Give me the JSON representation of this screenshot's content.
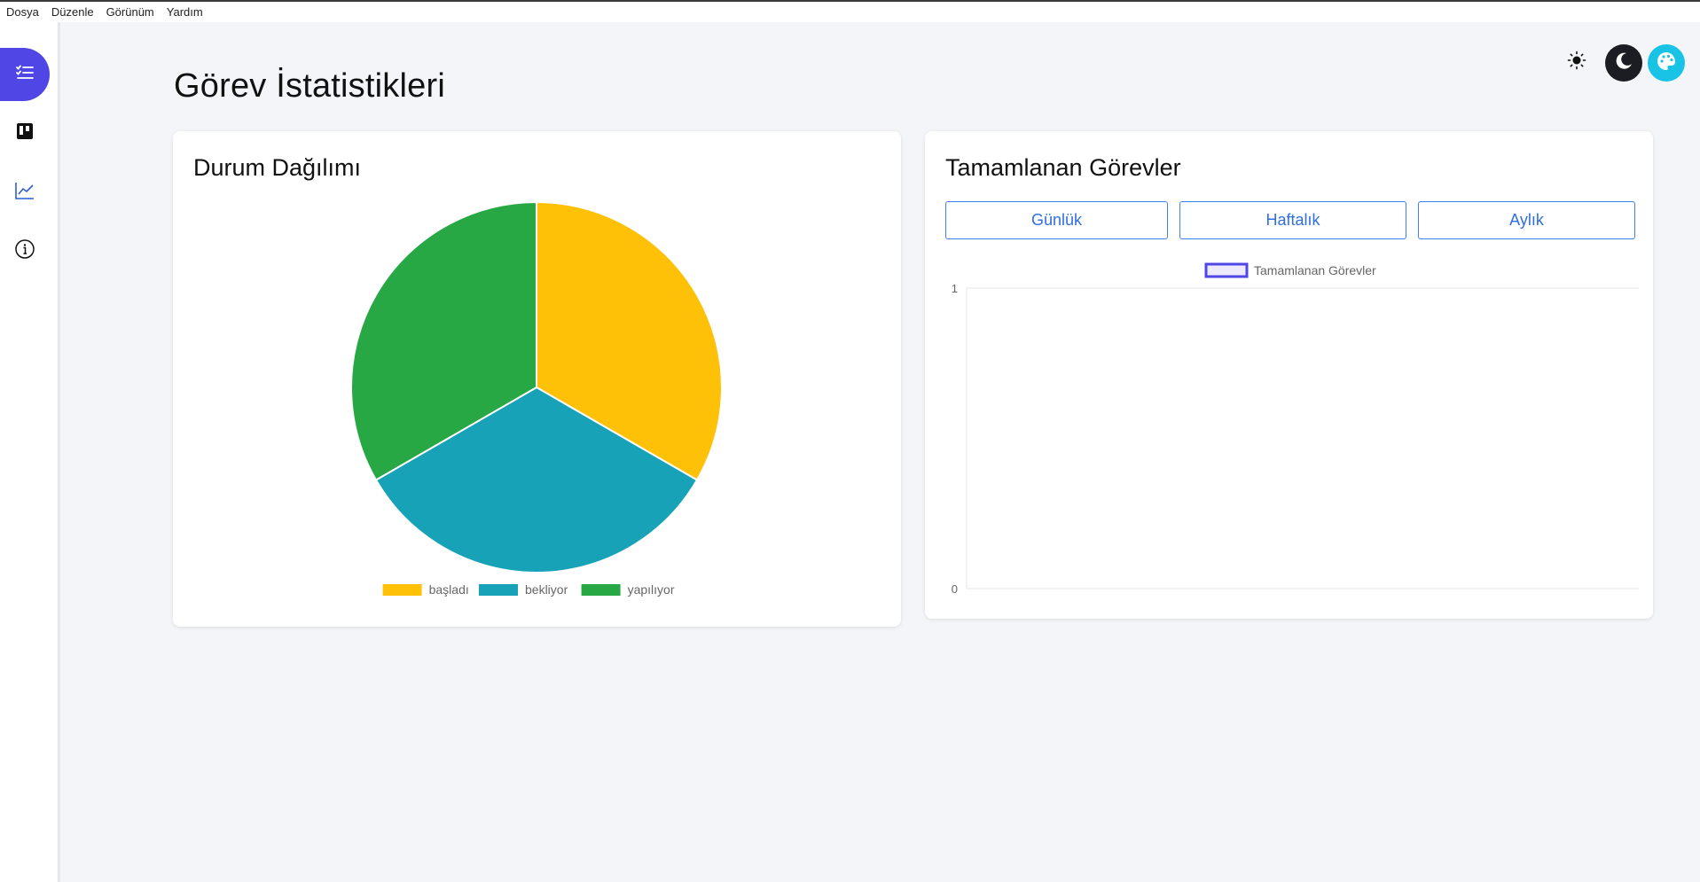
{
  "menu": {
    "items": [
      "Dosya",
      "Düzenle",
      "Görünüm",
      "Yardım"
    ]
  },
  "sidebar": {
    "items": [
      {
        "icon": "task-list-icon",
        "active": true
      },
      {
        "icon": "kanban-board-icon",
        "active": false
      },
      {
        "icon": "line-chart-icon",
        "active": false
      },
      {
        "icon": "info-icon",
        "active": false
      }
    ],
    "accent": "#4f46e5"
  },
  "page": {
    "title": "Görev İstatistikleri"
  },
  "theme": {
    "light_icon": "sun-icon",
    "dark_icon": "moon-icon",
    "custom_icon": "palette-icon"
  },
  "status_card": {
    "title": "Durum Dağılımı"
  },
  "completed_card": {
    "title": "Tamamlanan Görevler",
    "buttons": {
      "daily": "Günlük",
      "weekly": "Haftalık",
      "monthly": "Aylık"
    }
  },
  "chart_data": [
    {
      "type": "pie",
      "title": "Durum Dağılımı",
      "categories": [
        "başladı",
        "bekliyor",
        "yapılıyor"
      ],
      "values": [
        1,
        1,
        1
      ],
      "colors": [
        "#ffc107",
        "#17a2b8",
        "#28a745"
      ],
      "legend_position": "bottom"
    },
    {
      "type": "line",
      "title": "Tamamlanan Görevler",
      "series": [
        {
          "name": "Tamamlanan Görevler",
          "values": [],
          "color": "#5046e5"
        }
      ],
      "x": [],
      "ylim": [
        0,
        1
      ],
      "yticks": [
        "1",
        "0"
      ],
      "grid": true,
      "legend_position": "top"
    }
  ]
}
